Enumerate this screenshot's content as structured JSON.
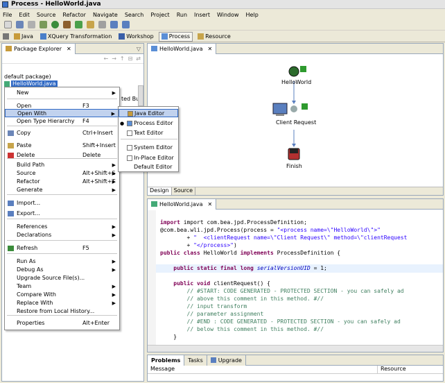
{
  "window": {
    "title": "Process - HelloWorld.java"
  },
  "menu": [
    "File",
    "Edit",
    "Source",
    "Refactor",
    "Navigate",
    "Search",
    "Project",
    "Run",
    "Insert",
    "Window",
    "Help"
  ],
  "perspectives": [
    {
      "label": "Java",
      "icon": "java-perspective-icon",
      "active": false
    },
    {
      "label": "XQuery Transformation",
      "icon": "xquery-icon",
      "active": false
    },
    {
      "label": "Workshop",
      "icon": "workshop-icon",
      "active": false
    },
    {
      "label": "Process",
      "icon": "process-icon",
      "active": true
    },
    {
      "label": "Resource",
      "icon": "resource-icon",
      "active": false
    }
  ],
  "explorer": {
    "tab": "Package Explorer",
    "default_package": "default package)",
    "selected_file": "HelloWorld.java",
    "peek_text": "ted Buil"
  },
  "context_menu": {
    "items": [
      {
        "label": "New",
        "shortcut": "",
        "submenu": true
      },
      {
        "label": "Open",
        "shortcut": "F3"
      },
      {
        "label": "Open With",
        "shortcut": "",
        "submenu": true,
        "highlight": true
      },
      {
        "label": "Open Type Hierarchy",
        "shortcut": "F4"
      },
      {
        "label": "Copy",
        "shortcut": "Ctrl+Insert",
        "icon": "copy-icon"
      },
      {
        "label": "Paste",
        "shortcut": "Shift+Insert",
        "icon": "paste-icon"
      },
      {
        "label": "Delete",
        "shortcut": "Delete",
        "icon": "delete-icon"
      },
      {
        "label": "Build Path",
        "shortcut": "",
        "submenu": true
      },
      {
        "label": "Source",
        "shortcut": "Alt+Shift+S",
        "submenu": true
      },
      {
        "label": "Refactor",
        "shortcut": "Alt+Shift+T",
        "submenu": true
      },
      {
        "label": "Generate",
        "shortcut": "",
        "submenu": true
      },
      {
        "label": "Import...",
        "shortcut": "",
        "icon": "import-icon"
      },
      {
        "label": "Export...",
        "shortcut": "",
        "icon": "export-icon"
      },
      {
        "label": "References",
        "shortcut": "",
        "submenu": true
      },
      {
        "label": "Declarations",
        "shortcut": "",
        "submenu": true
      },
      {
        "label": "Refresh",
        "shortcut": "F5",
        "icon": "refresh-icon"
      },
      {
        "label": "Run As",
        "shortcut": "",
        "submenu": true
      },
      {
        "label": "Debug As",
        "shortcut": "",
        "submenu": true
      },
      {
        "label": "Upgrade Source File(s)...",
        "shortcut": ""
      },
      {
        "label": "Team",
        "shortcut": "",
        "submenu": true
      },
      {
        "label": "Compare With",
        "shortcut": "",
        "submenu": true
      },
      {
        "label": "Replace With",
        "shortcut": "",
        "submenu": true
      },
      {
        "label": "Restore from Local History...",
        "shortcut": ""
      },
      {
        "label": "Properties",
        "shortcut": "Alt+Enter"
      }
    ]
  },
  "open_with_submenu": {
    "items": [
      {
        "label": "Java Editor",
        "highlight": true
      },
      {
        "label": "Process Editor",
        "checked": true
      },
      {
        "label": "Text Editor"
      },
      {
        "label": "System Editor"
      },
      {
        "label": "In-Place Editor"
      },
      {
        "label": "Default Editor"
      }
    ]
  },
  "process_editor": {
    "tab": "HelloWorld.java",
    "nodes": [
      "HelloWorld",
      "Client Request",
      "Finish"
    ],
    "bottom_tabs": [
      "Design",
      "Source"
    ]
  },
  "source_editor": {
    "tab": "HelloWorld.java",
    "lines": {
      "l1": "import com.bea.jpd.ProcessDefinition;",
      "l2a": "@com.bea.wli.jpd.Process(process = ",
      "l2b": "\"<process name=\\\"HelloWorld\\\">\"",
      "l3a": "        + ",
      "l3b": "\"  <clientRequest name=\\\"Client Request\\\" method=\\\"clientRequest",
      "l4a": "        + ",
      "l4b": "\"</process>\"",
      "l4c": ")",
      "l5a": "public class",
      "l5b": " HelloWorld ",
      "l5c": "implements",
      "l5d": " ProcessDefinition {",
      "l6a": "    public static final long ",
      "l6b": "serialVersionUID",
      "l6c": " = 1;",
      "l7a": "    public void",
      "l7b": " clientRequest() {",
      "c1": "        // #START: CODE GENERATED - PROTECTED SECTION - you can safely ad",
      "c2": "        // above this comment in this method. #//",
      "c3": "        // input transform",
      "c4": "        // parameter assignment",
      "c5": "        // #END : CODE GENERATED - PROTECTED SECTION - you can safely ad",
      "c6": "        // below this comment in this method. #//",
      "close": "    }"
    }
  },
  "problems": {
    "tabs": [
      "Problems",
      "Tasks",
      "Upgrade"
    ],
    "columns": [
      "Message",
      "Resource"
    ]
  }
}
